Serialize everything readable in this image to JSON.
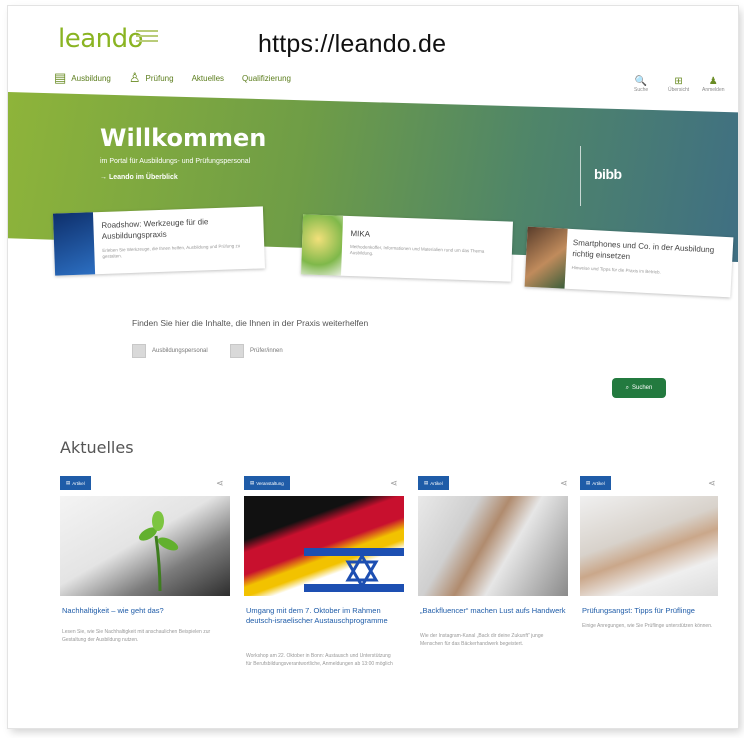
{
  "caption": {
    "url": "https://leando.de"
  },
  "brand": {
    "logo_text": "leando"
  },
  "nav": {
    "items": [
      {
        "label": "Ausbildung",
        "icon": "book-icon"
      },
      {
        "label": "Prüfung",
        "icon": "person-icon"
      },
      {
        "label": "Aktuelles",
        "icon": ""
      },
      {
        "label": "Qualifizierung",
        "icon": ""
      }
    ]
  },
  "utilities": [
    {
      "label": "Suche",
      "glyph": "🔍",
      "icon": "search-icon"
    },
    {
      "label": "Übersicht",
      "glyph": "⊞",
      "icon": "grid-icon"
    },
    {
      "label": "Anmelden",
      "glyph": "♟",
      "icon": "user-icon"
    }
  ],
  "hero": {
    "title": "Willkommen",
    "subtitle": "im Portal für Ausbildungs- und Prüfungspersonal",
    "link": "→ Leando im Überblick",
    "partner_logo": "bibb"
  },
  "featured": [
    {
      "title": "Roadshow: Werkzeuge für die Ausbildungspraxis",
      "text": "Erleben Sie Werkzeuge, die Ihnen helfen, Ausbildung und Prüfung zu gestalten."
    },
    {
      "title": "MIKA",
      "text": "Methodenkoffer, Informationen und Materialien rund um das Thema Ausbildung."
    },
    {
      "title": "Smartphones und Co. in der Ausbildung richtig einsetzen",
      "text": "Hinweise und Tipps für die Praxis im Betrieb."
    }
  ],
  "finder": {
    "label": "Finden Sie hier die Inhalte, die Ihnen in der Praxis weiterhelfen",
    "options": [
      "Ausbildungspersonal",
      "Prüfer/innen"
    ],
    "search_label": "Suchen"
  },
  "news_section": {
    "title": "Aktuelles"
  },
  "news": [
    {
      "tag": "Artikel",
      "title": "Nachhaltigkeit – wie geht das?",
      "text": "Lesen Sie, wie Sie Nachhaltigkeit mit anschaulichen Beispielen zur Gestaltung der Ausbildung nutzen."
    },
    {
      "tag": "Veranstaltung",
      "title": "Umgang mit dem 7. Oktober im Rahmen deutsch-israelischer Austauschprogramme",
      "text": "Workshop am 22. Oktober in Bonn: Austausch und Unterstützung für Berufsbildungsverantwortliche, Anmeldungen ab 13:00 möglich"
    },
    {
      "tag": "Artikel",
      "title": "„Backfluencer“ machen Lust aufs Handwerk",
      "text": "Wie der Instagram-Kanal „Back dir deine Zukunft“ junge Menschen für das Bäckerhandwerk begeistert."
    },
    {
      "tag": "Artikel",
      "title": "Prüfungsangst: Tipps für Prüflinge",
      "text": "Einige Anregungen, wie Sie Prüflinge unterstützen können."
    }
  ]
}
